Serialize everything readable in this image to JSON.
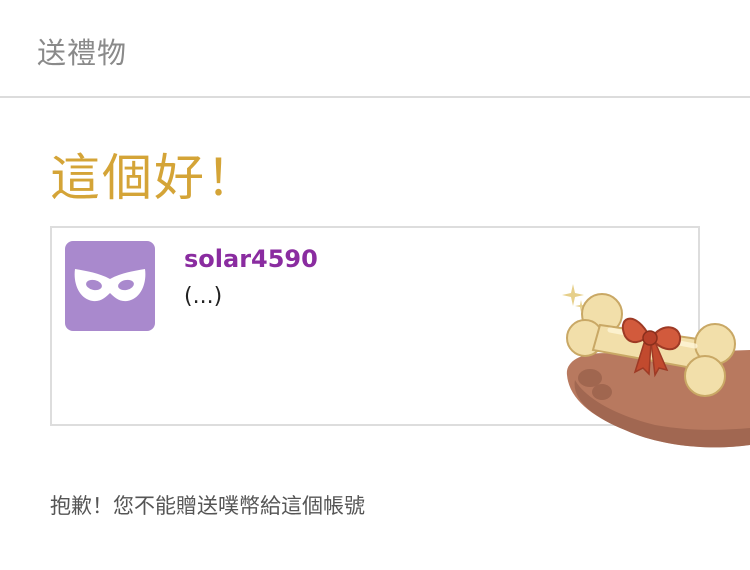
{
  "header": {
    "title": "送禮物"
  },
  "headline": "這個好！",
  "user_card": {
    "username": "solar4590",
    "message": "(...)",
    "avatar_icon": "mask-icon",
    "avatar_color": "#a989cd",
    "username_color": "#8a2ca0"
  },
  "sticker": {
    "icon": "bone-with-bow-sticker"
  },
  "notice": "抱歉！您不能贈送噗幣給這個帳號",
  "colors": {
    "headline": "#d4a437",
    "header_text": "#8a8a8a"
  }
}
